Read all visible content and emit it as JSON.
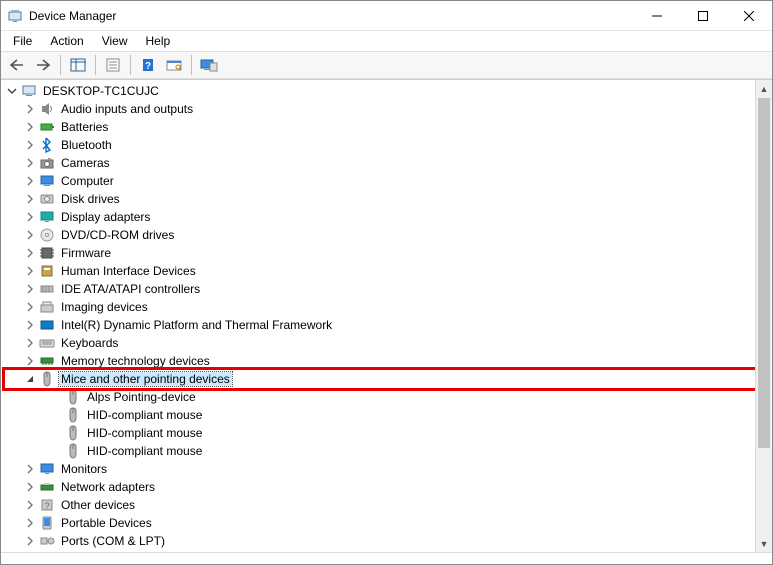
{
  "window": {
    "title": "Device Manager"
  },
  "menus": {
    "file": "File",
    "action": "Action",
    "view": "View",
    "help": "Help"
  },
  "tree": {
    "root": {
      "label": "DESKTOP-TC1CUJC"
    },
    "items": [
      {
        "label": "Audio inputs and outputs",
        "icon": "speaker"
      },
      {
        "label": "Batteries",
        "icon": "battery"
      },
      {
        "label": "Bluetooth",
        "icon": "bluetooth"
      },
      {
        "label": "Cameras",
        "icon": "camera"
      },
      {
        "label": "Computer",
        "icon": "computer"
      },
      {
        "label": "Disk drives",
        "icon": "disk"
      },
      {
        "label": "Display adapters",
        "icon": "display"
      },
      {
        "label": "DVD/CD-ROM drives",
        "icon": "dvd"
      },
      {
        "label": "Firmware",
        "icon": "chip"
      },
      {
        "label": "Human Interface Devices",
        "icon": "hid"
      },
      {
        "label": "IDE ATA/ATAPI controllers",
        "icon": "ide"
      },
      {
        "label": "Imaging devices",
        "icon": "imaging"
      },
      {
        "label": "Intel(R) Dynamic Platform and Thermal Framework",
        "icon": "intel"
      },
      {
        "label": "Keyboards",
        "icon": "keyboard"
      },
      {
        "label": "Memory technology devices",
        "icon": "memory"
      },
      {
        "label": "Mice and other pointing devices",
        "icon": "mouse",
        "expanded": true,
        "selected": true,
        "highlighted": true,
        "children": [
          {
            "label": "Alps Pointing-device",
            "icon": "mouse"
          },
          {
            "label": "HID-compliant mouse",
            "icon": "mouse"
          },
          {
            "label": "HID-compliant mouse",
            "icon": "mouse"
          },
          {
            "label": "HID-compliant mouse",
            "icon": "mouse"
          }
        ]
      },
      {
        "label": "Monitors",
        "icon": "monitor"
      },
      {
        "label": "Network adapters",
        "icon": "network"
      },
      {
        "label": "Other devices",
        "icon": "other"
      },
      {
        "label": "Portable Devices",
        "icon": "portable"
      },
      {
        "label": "Ports (COM & LPT)",
        "icon": "ports"
      }
    ]
  }
}
